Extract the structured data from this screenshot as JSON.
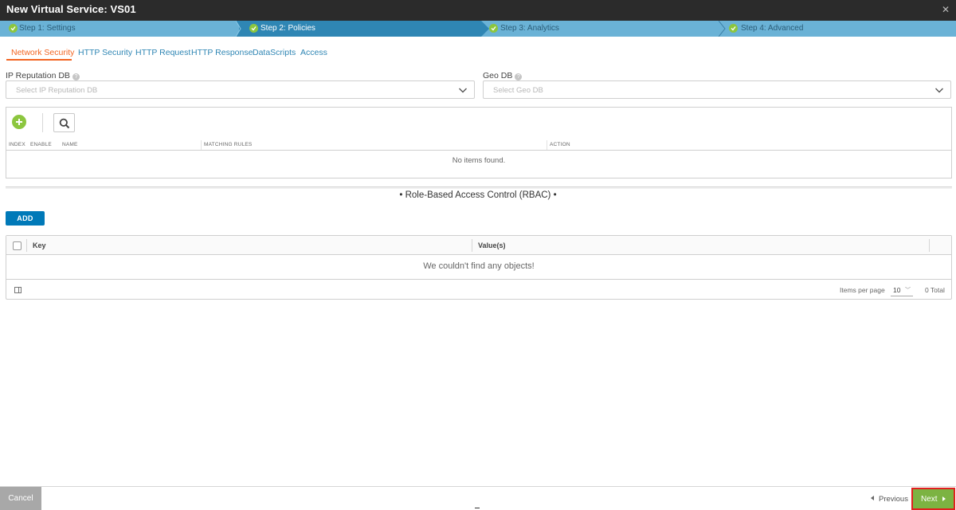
{
  "window": {
    "title": "New Virtual Service: VS01",
    "close_icon": "close-icon"
  },
  "wizard": {
    "steps": [
      {
        "label": "Step 1: Settings",
        "state": "complete"
      },
      {
        "label": "Step 2: Policies",
        "state": "active"
      },
      {
        "label": "Step 3: Analytics",
        "state": "complete"
      },
      {
        "label": "Step 4: Advanced",
        "state": "complete"
      }
    ],
    "colors": {
      "bar": "#6ab2d6",
      "active": "#2f86b4",
      "check": "#8cc63f"
    }
  },
  "tabs": [
    {
      "label": "Network Security",
      "active": true
    },
    {
      "label": "HTTP Security"
    },
    {
      "label": "HTTP Request"
    },
    {
      "label": "HTTP Response"
    },
    {
      "label": "DataScripts"
    },
    {
      "label": "Access"
    }
  ],
  "ip_reputation": {
    "label": "IP Reputation DB",
    "placeholder": "Select IP Reputation DB"
  },
  "geo_db": {
    "label": "Geo DB",
    "placeholder": "Select Geo DB"
  },
  "network_security_table": {
    "columns": [
      "INDEX",
      "ENABLE",
      "NAME",
      "MATCHING RULES",
      "ACTION"
    ],
    "empty_message": "No items found."
  },
  "rbac": {
    "title": "• Role-Based Access Control (RBAC) •",
    "add_label": "ADD",
    "columns": [
      "Key",
      "Value(s)"
    ],
    "empty_message": "We couldn't find any objects!",
    "items_per_page_label": "Items per page",
    "items_per_page_value": "10",
    "total_label": "0 Total"
  },
  "footer": {
    "cancel_label": "Cancel",
    "previous_label": "Previous",
    "next_label": "Next"
  }
}
